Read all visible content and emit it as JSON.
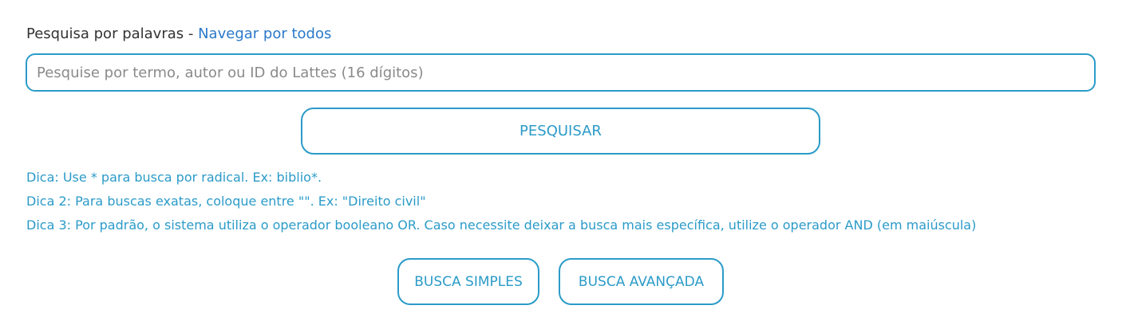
{
  "search": {
    "heading_label": "Pesquisa por palavras",
    "heading_separator": " - ",
    "browse_link": "Navegar por todos",
    "placeholder": "Pesquise por termo, autor ou ID do Lattes (16 dígitos)",
    "value": "",
    "submit_label": "PESQUISAR"
  },
  "tips": [
    "Dica: Use * para busca por radical. Ex: biblio*.",
    "Dica 2: Para buscas exatas, coloque entre \"\". Ex: \"Direito civil\"",
    "Dica 3: Por padrão, o sistema utiliza o operador booleano OR. Caso necessite deixar a busca mais específica, utilize o operador AND (em maiúscula)"
  ],
  "modes": {
    "simple_label": "BUSCA SIMPLES",
    "advanced_label": "BUSCA AVANÇADA"
  },
  "colors": {
    "accent": "#2b9bc8",
    "link": "#2a79c9",
    "text": "#333333",
    "placeholder": "#8a8a8a"
  }
}
